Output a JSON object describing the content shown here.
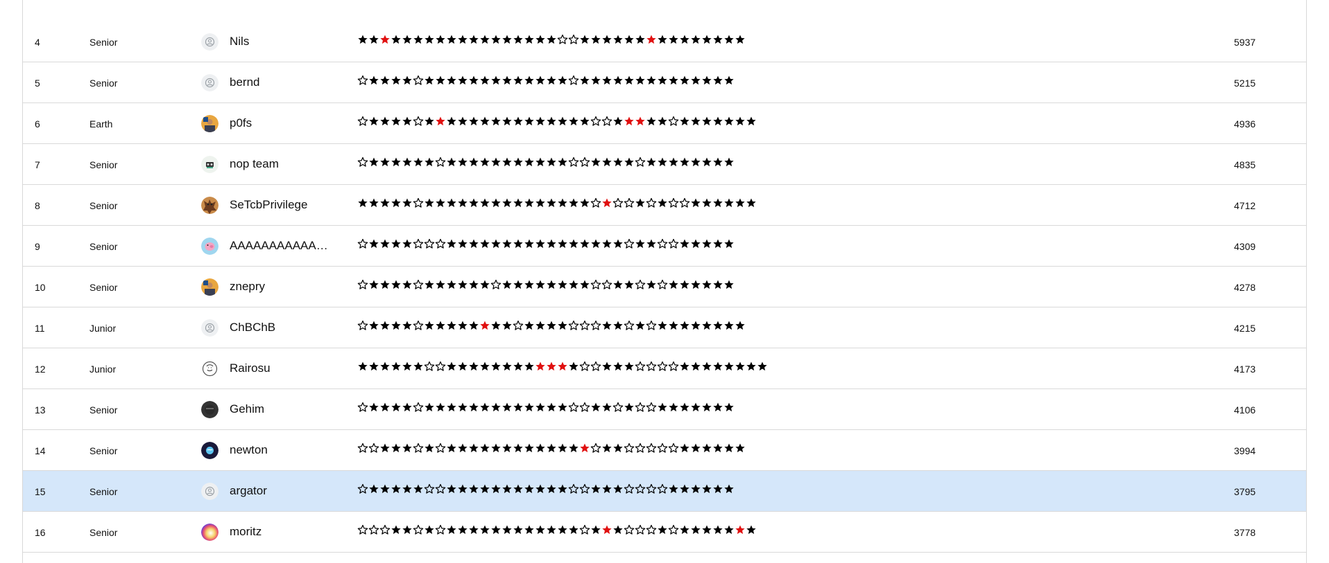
{
  "colors": {
    "solved": "#000000",
    "first_blood": "#e01010",
    "unsolved_outline": "#000000",
    "highlight_row": "#d5e7fa"
  },
  "rows": [
    {
      "rank": "4",
      "division": "Senior",
      "name": "Nils",
      "avatar": "default-avatar-icon",
      "score": "5937",
      "stars": "11r11111111111111100111111r11111111",
      "highlight": false
    },
    {
      "rank": "5",
      "division": "Senior",
      "name": "bernd",
      "avatar": "default-avatar-icon",
      "score": "5215",
      "stars": "0111101111111111111011111111111111",
      "highlight": false
    },
    {
      "rank": "6",
      "division": "Earth",
      "name": "p0fs",
      "avatar": "user-photo-icon",
      "score": "4936",
      "stars": "011110 1r1111111111111001rr1101111111",
      "highlight": false
    },
    {
      "rank": "7",
      "division": "Senior",
      "name": "nop team",
      "avatar": "team-logo-icon",
      "score": "4835",
      "stars": "0111111011111111111001111011111111",
      "highlight": false
    },
    {
      "rank": "8",
      "division": "Senior",
      "name": "SeTcbPrivilege",
      "avatar": "tiger-avatar-icon",
      "score": "4712",
      "stars": "1111101111111111111110r0010100111111",
      "highlight": false
    },
    {
      "rank": "9",
      "division": "Senior",
      "name": "AAAAAAAAAAAA…",
      "avatar": "pig-avatar-icon",
      "score": "4309",
      "stars": "0111100011111111111111110110011111",
      "highlight": false
    },
    {
      "rank": "10",
      "division": "Senior",
      "name": "znepry",
      "avatar": "user-photo-icon",
      "score": "4278",
      "stars": "0111101111110111111110011010111111",
      "highlight": false
    },
    {
      "rank": "11",
      "division": "Junior",
      "name": "ChBChB",
      "avatar": "default-avatar-icon",
      "score": "4215",
      "stars": "01111011111r11011110001101011111111",
      "highlight": false
    },
    {
      "rank": "12",
      "division": "Junior",
      "name": "Rairosu",
      "avatar": "sketch-avatar-icon",
      "score": "4173",
      "stars": "1111110011111111rrr100111000011111111",
      "highlight": false
    },
    {
      "rank": "13",
      "division": "Senior",
      "name": "Gehim",
      "avatar": "dark-avatar-icon",
      "score": "4106",
      "stars": "0111101111111111111001101001111111",
      "highlight": false
    },
    {
      "rank": "14",
      "division": "Senior",
      "name": "newton",
      "avatar": "globe-avatar-icon",
      "score": "3994",
      "stars": "00111010111111111111r01100000111111",
      "highlight": false
    },
    {
      "rank": "15",
      "division": "Senior",
      "name": "argator",
      "avatar": "default-avatar-icon",
      "score": "3795",
      "stars": "0111110011111111111001110000111111",
      "highlight": true
    },
    {
      "rank": "16",
      "division": "Senior",
      "name": "moritz",
      "avatar": "gradient-avatar-icon",
      "score": "3778",
      "stars": "0001101011111111111101r10001011111r1",
      "highlight": false
    }
  ]
}
